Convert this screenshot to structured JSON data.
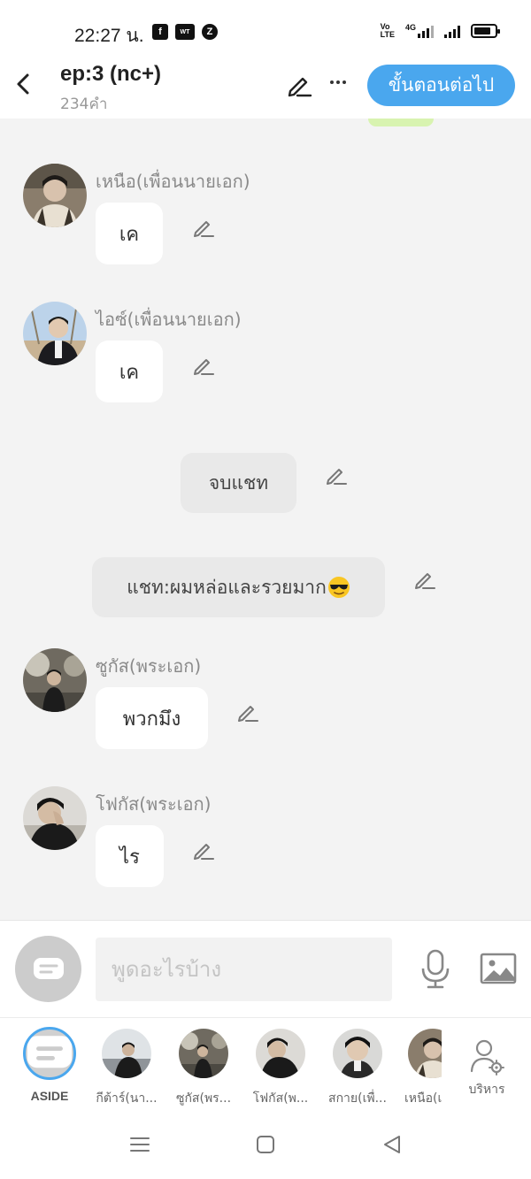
{
  "status_bar": {
    "time": "22:27 น.",
    "apps": [
      "facebook-icon",
      "webtoon-icon",
      "z-app-icon"
    ],
    "network": "4G",
    "volte": "Vo LTE",
    "battery_level": 0.8
  },
  "header": {
    "title": "ep:3 (nc+)",
    "word_count": "234คำ",
    "next_button": "ขั้นตอนต่อไป"
  },
  "messages": [
    {
      "type": "character",
      "sender": "เหนือ(เพื่อนนายเอก)",
      "text": "เค",
      "avatar": "avatar-nuea"
    },
    {
      "type": "character",
      "sender": "ไอซ์(เพื่อนนายเอก)",
      "text": "เค",
      "avatar": "avatar-ice"
    },
    {
      "type": "system",
      "text": "จบแชท"
    },
    {
      "type": "system",
      "text": "แชท:ผมหล่อและรวยมาก",
      "emoji": "sunglasses-emoji"
    },
    {
      "type": "character",
      "sender": "ซูกัส(พระเอก)",
      "text": "พวกมึง",
      "avatar": "avatar-sugus"
    },
    {
      "type": "character",
      "sender": "โฟกัส(พระเอก)",
      "text": "ไร",
      "avatar": "avatar-focus"
    }
  ],
  "input": {
    "placeholder": "พูดอะไรบ้าง",
    "value": ""
  },
  "characters": [
    {
      "label": "ASIDE"
    },
    {
      "label": "กีต้าร์(นา..."
    },
    {
      "label": "ซูกัส(พร..."
    },
    {
      "label": "โฟกัส(พ..."
    },
    {
      "label": "สกาย(เพื่..."
    },
    {
      "label": "เหนือ(เ"
    }
  ],
  "manage_label": "บริหาร",
  "colors": {
    "accent": "#4aa7ee",
    "background": "#f3f3f3",
    "bubble": "#ffffff",
    "system_bubble": "#e9e9e9"
  }
}
